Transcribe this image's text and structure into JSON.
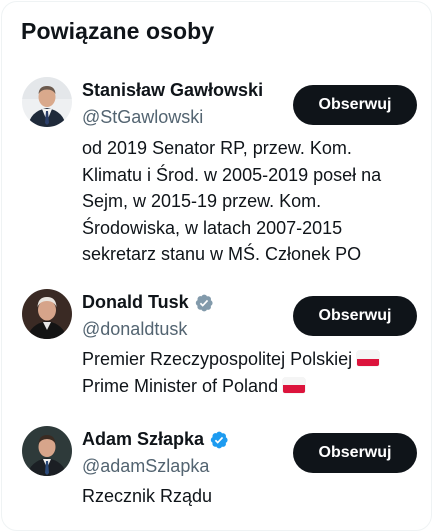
{
  "panel": {
    "title": "Powiązane osoby"
  },
  "people": [
    {
      "name": "Stanisław Gawłowski",
      "handle": "@StGawlowski",
      "verified": "none",
      "bio_lines": [
        "od 2019 Senator RP, przew. Kom.",
        "Klimatu i Środ. w 2005-2019 poseł na",
        "Sejm, w 2015-19 przew. Kom.",
        "Środowiska, w latach 2007-2015",
        "sekretarz stanu w MŚ. Członek PO"
      ],
      "follow_label": "Obserwuj"
    },
    {
      "name": "Donald Tusk",
      "handle": "@donaldtusk",
      "verified": "gray",
      "bio_lines": [
        "Premier Rzeczypospolitej Polskiej",
        "Prime Minister of Poland"
      ],
      "bio_flag": "poland-flag-emoji",
      "follow_label": "Obserwuj"
    },
    {
      "name": "Adam Szłapka",
      "handle": "@adamSzlapka",
      "verified": "blue",
      "bio_lines": [
        "Rzecznik Rządu"
      ],
      "follow_label": "Obserwuj"
    }
  ],
  "colors": {
    "text": "#0f1419",
    "secondary_text": "#536471",
    "button_bg": "#0f1419",
    "button_text": "#ffffff",
    "verified_blue": "#1d9bf0",
    "verified_gray": "#829aab",
    "border": "#eff3f4"
  }
}
